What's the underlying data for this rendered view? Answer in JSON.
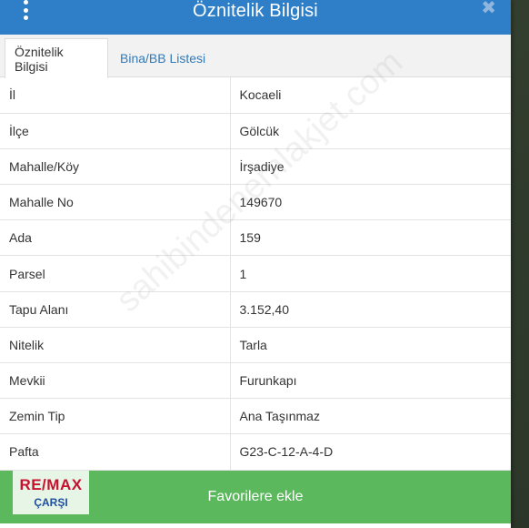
{
  "header": {
    "title": "Öznitelik Bilgisi",
    "menu_icon": "kebab-menu-icon",
    "close_icon": "close-icon",
    "close_symbol": "✖"
  },
  "tabs": [
    {
      "label": "Öznitelik Bilgisi"
    },
    {
      "label": "Bina/BB Listesi"
    }
  ],
  "rows": [
    {
      "key": "İl",
      "value": "Kocaeli"
    },
    {
      "key": "İlçe",
      "value": "Gölcük"
    },
    {
      "key": "Mahalle/Köy",
      "value": "İrşadiye"
    },
    {
      "key": "Mahalle No",
      "value": "149670"
    },
    {
      "key": "Ada",
      "value": "159"
    },
    {
      "key": "Parsel",
      "value": "1"
    },
    {
      "key": "Tapu Alanı",
      "value": "3.152,40"
    },
    {
      "key": "Nitelik",
      "value": "Tarla"
    },
    {
      "key": "Mevkii",
      "value": "Furunkapı"
    },
    {
      "key": "Zemin Tip",
      "value": "Ana Taşınmaz"
    },
    {
      "key": "Pafta",
      "value": "G23-C-12-A-4-D"
    }
  ],
  "watermark": "sahibindenemlakjet.com",
  "footer": {
    "favorite_label": "Favorilere ekle"
  },
  "logo": {
    "line1": "RE/MAX",
    "line2": "ÇARŞI"
  },
  "colors": {
    "header": "#2f7fc8",
    "footer": "#5cb85c",
    "tab_link": "#337ab7"
  }
}
